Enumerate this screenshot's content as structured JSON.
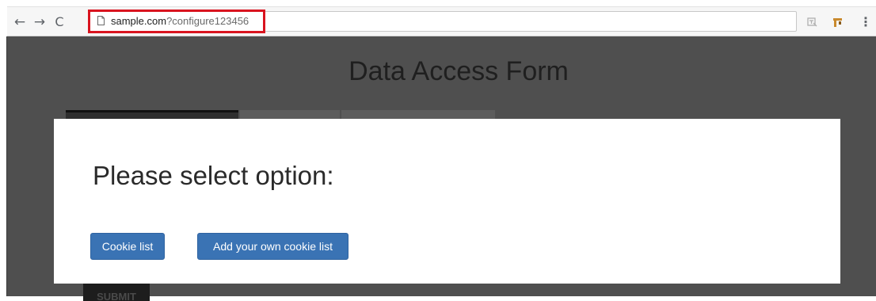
{
  "browser": {
    "back_icon": "←",
    "forward_icon": "→",
    "reload_icon": "C",
    "url_host": "sample.com",
    "url_path": "?configure123456",
    "menu_icon": "⋮",
    "highlight_color": "#d9141f"
  },
  "page": {
    "title": "Data Access Form",
    "submit_label": "SUBMIT"
  },
  "modal": {
    "title": "Please select option:",
    "buttons": [
      {
        "label": "Cookie list"
      },
      {
        "label": "Add your own cookie list"
      }
    ],
    "button_color": "#3a73b4"
  }
}
